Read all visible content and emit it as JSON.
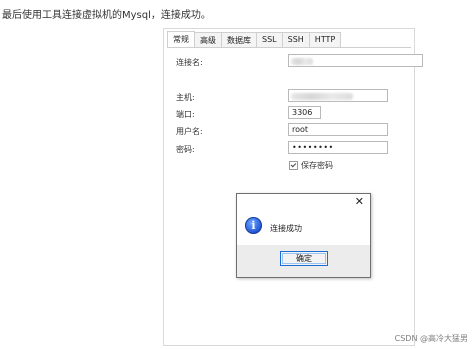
{
  "caption": "最后使用工具连接虚拟机的Mysql，连接成功。",
  "window": {
    "tabs": [
      {
        "label": "常规",
        "active": true
      },
      {
        "label": "高级",
        "active": false
      },
      {
        "label": "数据库",
        "active": false
      },
      {
        "label": "SSL",
        "active": false
      },
      {
        "label": "SSH",
        "active": false
      },
      {
        "label": "HTTP",
        "active": false
      }
    ],
    "fields": {
      "connection_name_label": "连接名:",
      "host_label": "主机:",
      "port_label": "端口:",
      "port_value": "3306",
      "username_label": "用户名:",
      "username_value": "root",
      "password_label": "密码:",
      "password_value": "••••••••"
    },
    "save_password_label": "保存密码"
  },
  "dialog": {
    "message": "连接成功",
    "ok_label": "确定",
    "close_glyph": "✕"
  },
  "watermark": "CSDN @高冷大猛男"
}
